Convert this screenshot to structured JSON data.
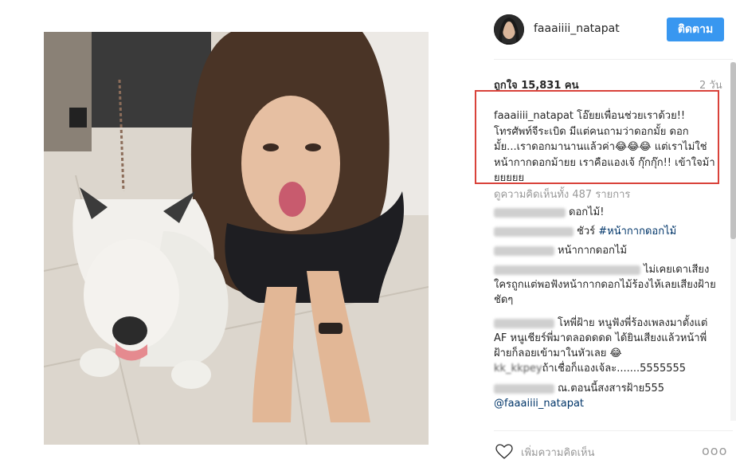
{
  "post": {
    "username": "faaaiiii_natapat",
    "follow_label": "ติดตาม",
    "likes": "ถูกใจ 15,831 คน",
    "time": "2 วัน",
    "caption_user": "faaaiiii_natapat",
    "caption_text": " โอ๊ยยเพื่อนช่วยเราด้วย!! โทรศัพท์จีระเบิด มีแต่คนถามว่าดอกมั้ย ดอกมั้ย...เราดอกมานานแล้วค่า😂😂😂 แต่เราไม่ใช่หน้ากากดอกม้ายย เราคือแองเจ้ กุ๊กกุ๊ก!! เข้าใจม้ายยยยย",
    "view_all": "ดูความคิดเห็นทั้ง 487 รายการ",
    "comments": [
      {
        "text": "ดอกไม้!"
      },
      {
        "text": "ชัวร์ ",
        "tag": "#หน้ากากดอกไม้"
      },
      {
        "text": "หน้ากากดอกไม้"
      },
      {
        "text": "ไม่เคยเดาเสียงใครถูกแต่พอฟังหน้ากากดอกไม้ร้องไห้เลยเสียงฝ้ายชัดๆ"
      },
      {
        "text": "โหพี่ฝ้าย หนูฟังพี่ร้องเพลงมาตั้งแต่ AF หนูเชียร์พี่มาตลอดดดด ได้ยินเสียงแล้วหน้าพี่ฝ้ายก็ลอยเข้ามาในหัวเลย 😂"
      },
      {
        "text": "ถ้าเชื่อก็แองเจ้ละ.......5555555",
        "prefix": "kk_kkpey"
      },
      {
        "text": "ณ.ตอนนี้สงสารฝ้าย555",
        "mention": "@faaaiiii_natapat"
      }
    ],
    "add_comment": "เพิ่มความคิดเห็น",
    "options": "ooo"
  },
  "icons": {
    "heart": "heart-icon",
    "more": "more-options-icon"
  },
  "colors": {
    "accent": "#3897f0",
    "highlight_border": "#d9423a",
    "hashtag": "#003569"
  }
}
